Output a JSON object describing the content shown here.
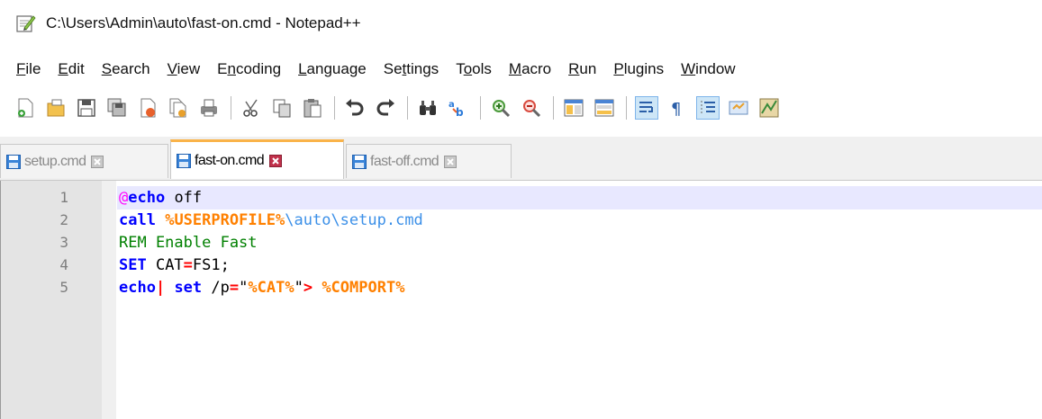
{
  "window": {
    "title": "C:\\Users\\Admin\\auto\\fast-on.cmd - Notepad++"
  },
  "menu": [
    {
      "ul": "F",
      "rest": "ile"
    },
    {
      "ul": "E",
      "rest": "dit"
    },
    {
      "ul": "S",
      "rest": "earch"
    },
    {
      "ul": "V",
      "rest": "iew"
    },
    {
      "pre": "E",
      "ul": "n",
      "rest": "coding"
    },
    {
      "ul": "L",
      "rest": "anguage"
    },
    {
      "pre": "Se",
      "ul": "t",
      "rest": "tings"
    },
    {
      "pre": "T",
      "ul": "o",
      "rest": "ols"
    },
    {
      "ul": "M",
      "rest": "acro"
    },
    {
      "ul": "R",
      "rest": "un"
    },
    {
      "ul": "P",
      "rest": "lugins"
    },
    {
      "ul": "W",
      "rest": "indow"
    }
  ],
  "toolbar_icons": [
    "new-file-icon",
    "open-file-icon",
    "save-icon",
    "save-all-icon",
    "close-icon",
    "close-all-icon",
    "print-icon",
    "cut-icon",
    "copy-icon",
    "paste-icon",
    "undo-icon",
    "redo-icon",
    "find-icon",
    "replace-icon",
    "zoom-in-icon",
    "zoom-out-icon",
    "sync-vertical-icon",
    "sync-horizontal-icon",
    "word-wrap-icon",
    "show-all-characters-icon",
    "indent-guide-icon",
    "udl-icon",
    "document-map-icon"
  ],
  "tabs": [
    {
      "label": "setup.cmd",
      "active": false
    },
    {
      "label": "fast-on.cmd",
      "active": true
    },
    {
      "label": "fast-off.cmd",
      "active": false
    }
  ],
  "editor": {
    "line_numbers": [
      "1",
      "2",
      "3",
      "4",
      "5"
    ],
    "lines": [
      {
        "tokens": [
          {
            "t": "@",
            "c": "c-at"
          },
          {
            "t": "echo",
            "c": "c-kw"
          },
          {
            "t": " off",
            "c": "c-plain"
          }
        ]
      },
      {
        "tokens": [
          {
            "t": "call",
            "c": "c-kw"
          },
          {
            "t": " ",
            "c": "c-plain"
          },
          {
            "t": "%USERPROFILE%",
            "c": "c-var"
          },
          {
            "t": "\\auto\\setup.cmd",
            "c": "c-path"
          }
        ]
      },
      {
        "tokens": [
          {
            "t": "REM Enable Fast",
            "c": "c-rem"
          }
        ]
      },
      {
        "tokens": [
          {
            "t": "SET",
            "c": "c-kw"
          },
          {
            "t": " CAT",
            "c": "c-plain"
          },
          {
            "t": "=",
            "c": "c-red"
          },
          {
            "t": "FS1;",
            "c": "c-plain"
          }
        ]
      },
      {
        "tokens": [
          {
            "t": "echo",
            "c": "c-kw"
          },
          {
            "t": "|",
            "c": "c-red"
          },
          {
            "t": " set",
            "c": "c-kw"
          },
          {
            "t": " /p",
            "c": "c-plain"
          },
          {
            "t": "=",
            "c": "c-red"
          },
          {
            "t": "\"",
            "c": "c-plain"
          },
          {
            "t": "%CAT%",
            "c": "c-var"
          },
          {
            "t": "\"",
            "c": "c-plain"
          },
          {
            "t": ">",
            "c": "c-red"
          },
          {
            "t": " ",
            "c": "c-plain"
          },
          {
            "t": "%COMPORT%",
            "c": "c-var"
          }
        ]
      }
    ]
  },
  "colors": {
    "active_tab_accent": "#fab349",
    "current_line": "#e8e8ff",
    "gutter": "#e4e4e4"
  }
}
